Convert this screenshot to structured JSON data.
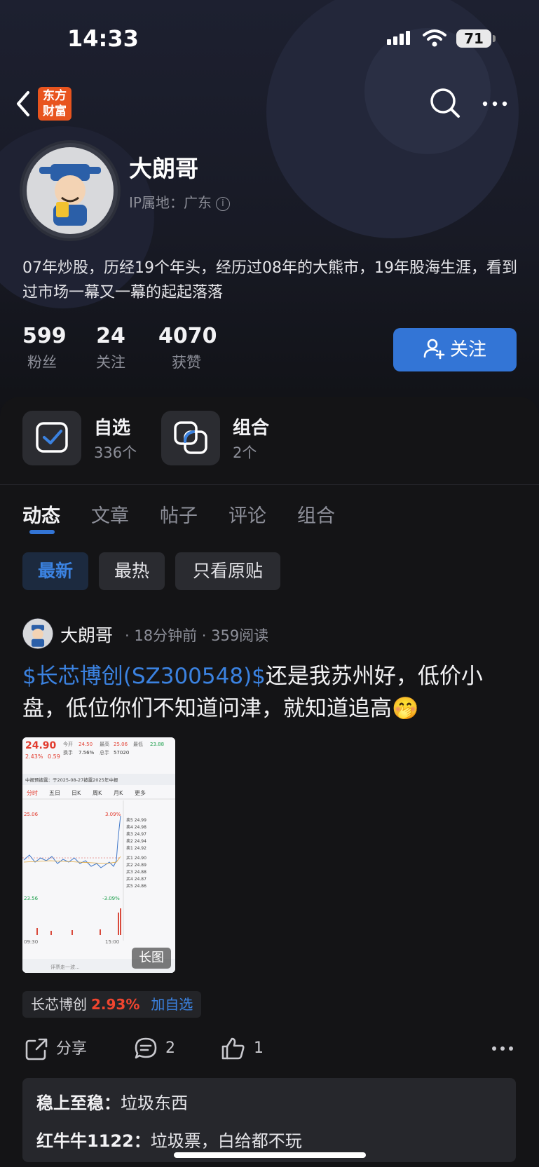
{
  "status_bar": {
    "time": "14:33",
    "battery": "71"
  },
  "nav": {
    "logo_line1": "东方",
    "logo_line2": "财富"
  },
  "profile": {
    "name": "大朗哥",
    "ip_location": "IP属地：广东",
    "bio": "07年炒股，历经19个年头，经历过08年的大熊市，19年股海生涯，看到过市场一幕又一幕的起起落落",
    "stats": [
      {
        "value": "599",
        "label": "粉丝"
      },
      {
        "value": "24",
        "label": "关注"
      },
      {
        "value": "4070",
        "label": "获赞"
      }
    ],
    "follow_label": "关注"
  },
  "quick_links": [
    {
      "title": "自选",
      "sub": "336个",
      "icon": "checkbox-icon"
    },
    {
      "title": "组合",
      "sub": "2个",
      "icon": "portfolio-icon"
    }
  ],
  "tabs": [
    "动态",
    "文章",
    "帖子",
    "评论",
    "组合"
  ],
  "active_tab": "动态",
  "filters": [
    "最新",
    "最热",
    "只看原贴"
  ],
  "active_filter": "最新",
  "post": {
    "author": "大朗哥",
    "meta": "· 18分钟前 · 359阅读",
    "stock_link": "$长芯博创(SZ300548)$",
    "text": "还是我苏州好，低价小盘，低位你们不知道问津，就知道追高",
    "emoji": "🤭",
    "image_badge": "长图",
    "stock_tag": {
      "name": "长芯博创",
      "change": "2.93%",
      "add": "加自选"
    },
    "actions": {
      "share": "分享",
      "comments": "2",
      "likes": "1"
    },
    "comments": [
      {
        "user": "稳上至稳：",
        "text": "垃圾东西"
      },
      {
        "user": "红牛牛1122：",
        "text": "垃圾票，白给都不玩"
      }
    ]
  },
  "thumbnail": {
    "price": "24.90",
    "open": "24.50",
    "high": "25.06",
    "low": "23.88",
    "change_pct": "2.43%",
    "change": "0.59",
    "turnover": "7.56%",
    "volume": "57020",
    "notice": "中报预披露：于2025-08-27披露2025年中报",
    "tabs": [
      "分时",
      "五日",
      "日K",
      "周K",
      "月K",
      "更多"
    ],
    "top_pct": "3.09%",
    "bottom_pct": "-3.09%",
    "top_price": "25.06",
    "bottom_price": "23.56",
    "time_start": "09:30",
    "time_end": "15:00",
    "input_placeholder": "评票走一波..."
  },
  "colors": {
    "accent": "#3375d6",
    "link": "#3b82e0",
    "up": "#f0452f",
    "logo": "#e8541e"
  }
}
